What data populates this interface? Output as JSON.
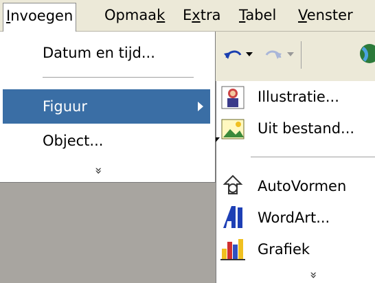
{
  "menubar": {
    "items": [
      {
        "label": "Invoegen",
        "underline": "I"
      },
      {
        "label": "Opmaak",
        "underline": "k"
      },
      {
        "label": "Extra",
        "underline": "x"
      },
      {
        "label": "Tabel",
        "underline": "T"
      },
      {
        "label": "Venster",
        "underline": "V"
      }
    ]
  },
  "insert_menu": {
    "items": [
      {
        "label": "Datum en tijd..."
      },
      {
        "label": "Figuur",
        "selected": true
      },
      {
        "label": "Object..."
      }
    ],
    "expand_glyph": "»"
  },
  "figure_submenu": {
    "items": [
      {
        "label": "Illustratie...",
        "icon": "clipart-icon"
      },
      {
        "label": "Uit bestand...",
        "icon": "image-file-icon"
      },
      {
        "label": "AutoVormen",
        "icon": "autoshapes-icon"
      },
      {
        "label": "WordArt...",
        "icon": "wordart-icon"
      },
      {
        "label": "Grafiek",
        "icon": "chart-icon"
      }
    ]
  },
  "colors": {
    "menubar_bg": "#ece9d8",
    "selection": "#3a6ea5",
    "menu_bg": "#ffffff"
  }
}
